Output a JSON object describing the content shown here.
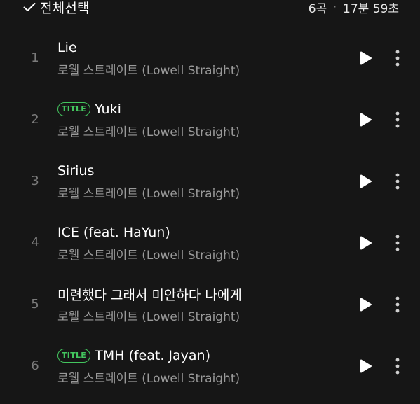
{
  "header": {
    "select_all_label": "전체선택",
    "track_count": "6곡",
    "separator": "·",
    "total_duration": "17분 59초"
  },
  "tracks": [
    {
      "number": "1",
      "title": "Lie",
      "badge": "",
      "artist": "로웰 스트레이트 (Lowell Straight)"
    },
    {
      "number": "2",
      "title": "Yuki",
      "badge": "TITLE",
      "artist": "로웰 스트레이트 (Lowell Straight)"
    },
    {
      "number": "3",
      "title": "Sirius",
      "badge": "",
      "artist": "로웰 스트레이트 (Lowell Straight)"
    },
    {
      "number": "4",
      "title": "ICE (feat. HaYun)",
      "badge": "",
      "artist": "로웰 스트레이트 (Lowell Straight)"
    },
    {
      "number": "5",
      "title": "미련했다 그래서 미안하다 나에게",
      "badge": "",
      "artist": "로웰 스트레이트 (Lowell Straight)"
    },
    {
      "number": "6",
      "title": "TMH (feat. Jayan)",
      "badge": "TITLE",
      "artist": "로웰 스트레이트 (Lowell Straight)"
    }
  ],
  "icons": {
    "select_all": "check-icon",
    "play": "play-icon",
    "more": "more-vertical-icon"
  },
  "colors": {
    "background": "#161616",
    "accent": "#43c55e",
    "secondary_text": "#9a9a9a",
    "track_number": "#7b7b7b"
  }
}
